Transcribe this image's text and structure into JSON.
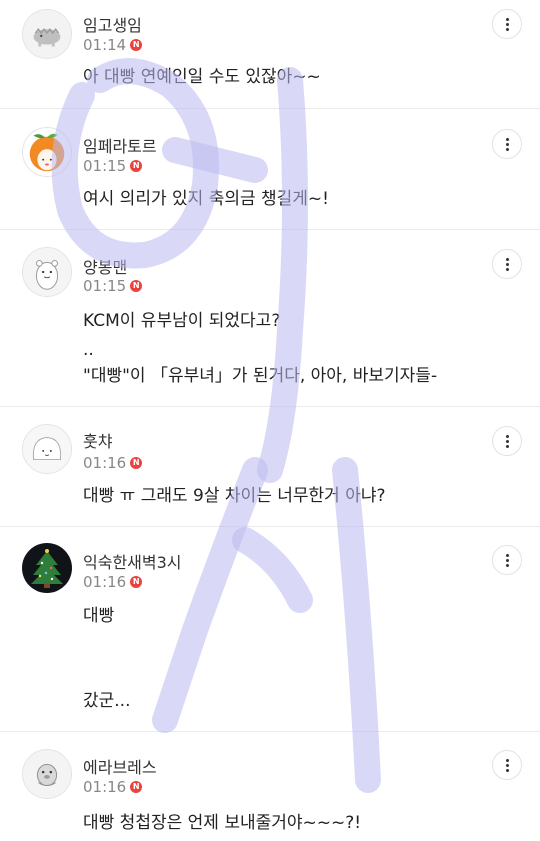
{
  "comments": [
    {
      "nickname": "임고생임",
      "time": "01:14",
      "badge": "N",
      "text": [
        "아 대빵 연예인일 수도 있잖아~~"
      ],
      "avatar": "dinosaur-icon"
    },
    {
      "nickname": "임페라토르",
      "time": "01:15",
      "badge": "N",
      "text": [
        "여시 의리가 있지 축의금 챙길게~!"
      ],
      "avatar": "tangerine-icon"
    },
    {
      "nickname": "양봉맨",
      "time": "01:15",
      "badge": "N",
      "text": [
        "KCM이 유부남이 되었다고?",
        "..",
        "\"대빵\"이 「유부녀」가 된거다, 아아, 바보기자들-"
      ],
      "avatar": "animal-icon"
    },
    {
      "nickname": "훗챠",
      "time": "01:16",
      "badge": "N",
      "text": [
        "대빵 ㅠ 그래도 9살 차이는 너무한거 아냐?"
      ],
      "avatar": "blob-icon"
    },
    {
      "nickname": "익숙한새벽3시",
      "time": "01:16",
      "badge": "N",
      "text": [
        "대빵",
        "",
        "",
        "갔군..."
      ],
      "avatar": "christmas-tree-icon"
    },
    {
      "nickname": "에라브레스",
      "time": "01:16",
      "badge": "N",
      "text": [
        "대빵 청첩장은 언제 보내줄거야~~~?!"
      ],
      "avatar": "seal-icon"
    }
  ],
  "colors": {
    "badge": "#e8433f",
    "watermark": "#b9b9f0",
    "divider": "#ebebeb"
  },
  "icons": {
    "more": "more-vertical-icon"
  }
}
